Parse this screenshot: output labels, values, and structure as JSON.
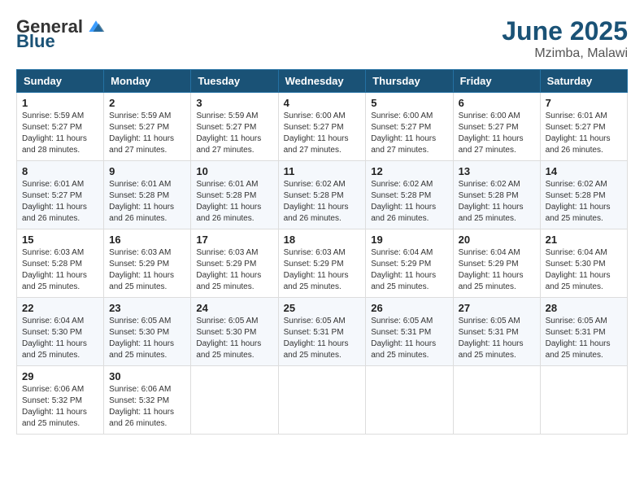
{
  "logo": {
    "general": "General",
    "blue": "Blue"
  },
  "title": {
    "month_year": "June 2025",
    "location": "Mzimba, Malawi"
  },
  "headers": [
    "Sunday",
    "Monday",
    "Tuesday",
    "Wednesday",
    "Thursday",
    "Friday",
    "Saturday"
  ],
  "weeks": [
    [
      {
        "day": "1",
        "sunrise": "5:59 AM",
        "sunset": "5:27 PM",
        "daylight": "11 hours and 28 minutes."
      },
      {
        "day": "2",
        "sunrise": "5:59 AM",
        "sunset": "5:27 PM",
        "daylight": "11 hours and 27 minutes."
      },
      {
        "day": "3",
        "sunrise": "5:59 AM",
        "sunset": "5:27 PM",
        "daylight": "11 hours and 27 minutes."
      },
      {
        "day": "4",
        "sunrise": "6:00 AM",
        "sunset": "5:27 PM",
        "daylight": "11 hours and 27 minutes."
      },
      {
        "day": "5",
        "sunrise": "6:00 AM",
        "sunset": "5:27 PM",
        "daylight": "11 hours and 27 minutes."
      },
      {
        "day": "6",
        "sunrise": "6:00 AM",
        "sunset": "5:27 PM",
        "daylight": "11 hours and 27 minutes."
      },
      {
        "day": "7",
        "sunrise": "6:01 AM",
        "sunset": "5:27 PM",
        "daylight": "11 hours and 26 minutes."
      }
    ],
    [
      {
        "day": "8",
        "sunrise": "6:01 AM",
        "sunset": "5:27 PM",
        "daylight": "11 hours and 26 minutes."
      },
      {
        "day": "9",
        "sunrise": "6:01 AM",
        "sunset": "5:28 PM",
        "daylight": "11 hours and 26 minutes."
      },
      {
        "day": "10",
        "sunrise": "6:01 AM",
        "sunset": "5:28 PM",
        "daylight": "11 hours and 26 minutes."
      },
      {
        "day": "11",
        "sunrise": "6:02 AM",
        "sunset": "5:28 PM",
        "daylight": "11 hours and 26 minutes."
      },
      {
        "day": "12",
        "sunrise": "6:02 AM",
        "sunset": "5:28 PM",
        "daylight": "11 hours and 26 minutes."
      },
      {
        "day": "13",
        "sunrise": "6:02 AM",
        "sunset": "5:28 PM",
        "daylight": "11 hours and 25 minutes."
      },
      {
        "day": "14",
        "sunrise": "6:02 AM",
        "sunset": "5:28 PM",
        "daylight": "11 hours and 25 minutes."
      }
    ],
    [
      {
        "day": "15",
        "sunrise": "6:03 AM",
        "sunset": "5:28 PM",
        "daylight": "11 hours and 25 minutes."
      },
      {
        "day": "16",
        "sunrise": "6:03 AM",
        "sunset": "5:29 PM",
        "daylight": "11 hours and 25 minutes."
      },
      {
        "day": "17",
        "sunrise": "6:03 AM",
        "sunset": "5:29 PM",
        "daylight": "11 hours and 25 minutes."
      },
      {
        "day": "18",
        "sunrise": "6:03 AM",
        "sunset": "5:29 PM",
        "daylight": "11 hours and 25 minutes."
      },
      {
        "day": "19",
        "sunrise": "6:04 AM",
        "sunset": "5:29 PM",
        "daylight": "11 hours and 25 minutes."
      },
      {
        "day": "20",
        "sunrise": "6:04 AM",
        "sunset": "5:29 PM",
        "daylight": "11 hours and 25 minutes."
      },
      {
        "day": "21",
        "sunrise": "6:04 AM",
        "sunset": "5:30 PM",
        "daylight": "11 hours and 25 minutes."
      }
    ],
    [
      {
        "day": "22",
        "sunrise": "6:04 AM",
        "sunset": "5:30 PM",
        "daylight": "11 hours and 25 minutes."
      },
      {
        "day": "23",
        "sunrise": "6:05 AM",
        "sunset": "5:30 PM",
        "daylight": "11 hours and 25 minutes."
      },
      {
        "day": "24",
        "sunrise": "6:05 AM",
        "sunset": "5:30 PM",
        "daylight": "11 hours and 25 minutes."
      },
      {
        "day": "25",
        "sunrise": "6:05 AM",
        "sunset": "5:31 PM",
        "daylight": "11 hours and 25 minutes."
      },
      {
        "day": "26",
        "sunrise": "6:05 AM",
        "sunset": "5:31 PM",
        "daylight": "11 hours and 25 minutes."
      },
      {
        "day": "27",
        "sunrise": "6:05 AM",
        "sunset": "5:31 PM",
        "daylight": "11 hours and 25 minutes."
      },
      {
        "day": "28",
        "sunrise": "6:05 AM",
        "sunset": "5:31 PM",
        "daylight": "11 hours and 25 minutes."
      }
    ],
    [
      {
        "day": "29",
        "sunrise": "6:06 AM",
        "sunset": "5:32 PM",
        "daylight": "11 hours and 25 minutes."
      },
      {
        "day": "30",
        "sunrise": "6:06 AM",
        "sunset": "5:32 PM",
        "daylight": "11 hours and 26 minutes."
      },
      null,
      null,
      null,
      null,
      null
    ]
  ]
}
